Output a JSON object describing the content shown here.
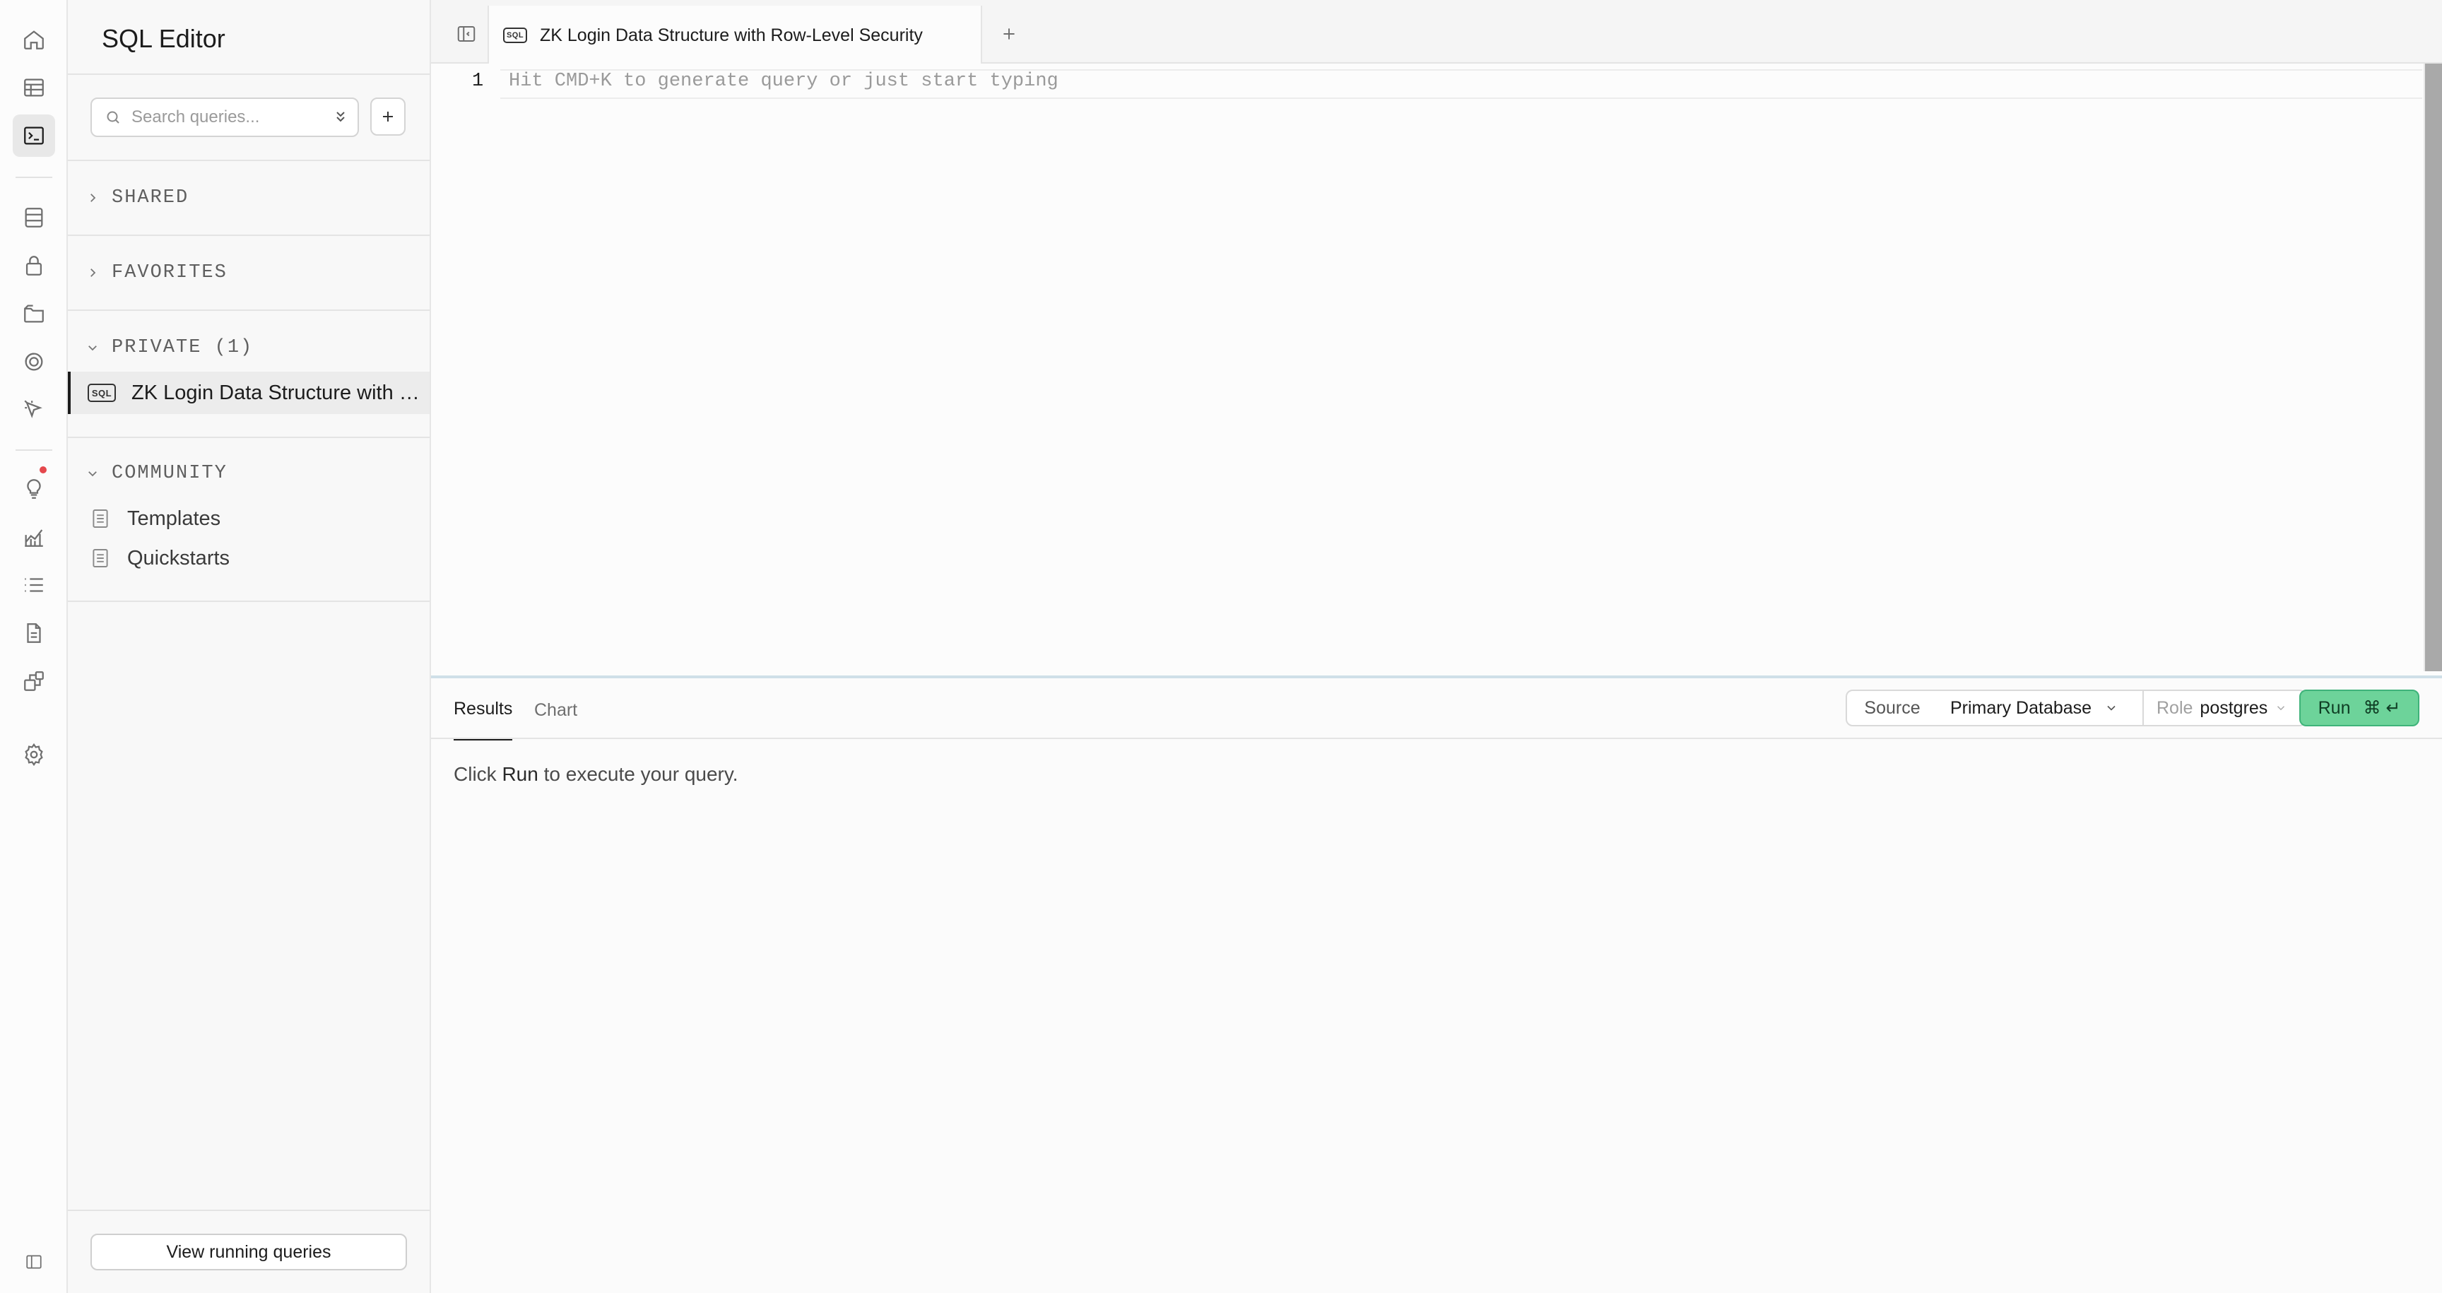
{
  "sidebar": {
    "title": "SQL Editor",
    "search": {
      "placeholder": "Search queries..."
    },
    "sections": {
      "shared": "SHARED",
      "favorites": "FAVORITES",
      "private": "PRIVATE (1)",
      "community": "COMMUNITY"
    },
    "private_items": [
      {
        "icon_text": "SQL",
        "label": "ZK Login Data Structure with Row-Level Security"
      }
    ],
    "community_items": [
      {
        "label": "Templates"
      },
      {
        "label": "Quickstarts"
      }
    ],
    "footer_button": "View running queries"
  },
  "nav_icons": [
    "home-icon",
    "table-editor-icon",
    "sql-editor-icon",
    "database-icon",
    "auth-icon",
    "storage-icon",
    "realtime-icon",
    "edge-functions-icon",
    "advisors-icon",
    "reports-icon",
    "logs-icon",
    "docs-icon",
    "integrations-icon",
    "settings-icon",
    "collapse-icon"
  ],
  "tab": {
    "icon_text": "SQL",
    "title": "ZK Login Data Structure with Row-Level Security"
  },
  "editor": {
    "line_number": "1",
    "placeholder": "Hit CMD+K to generate query or just start typing"
  },
  "results": {
    "tabs": [
      "Results",
      "Chart"
    ],
    "source_label": "Source",
    "database": "Primary Database",
    "role_label": "Role",
    "role": "postgres",
    "run_label": "Run",
    "run_shortcut": "⌘ ↵",
    "hint_prefix": "Click",
    "hint_run": "Run",
    "hint_suffix": "to execute your query."
  },
  "colors": {
    "accent": "#6dd39a",
    "notification": "#e5484d"
  }
}
